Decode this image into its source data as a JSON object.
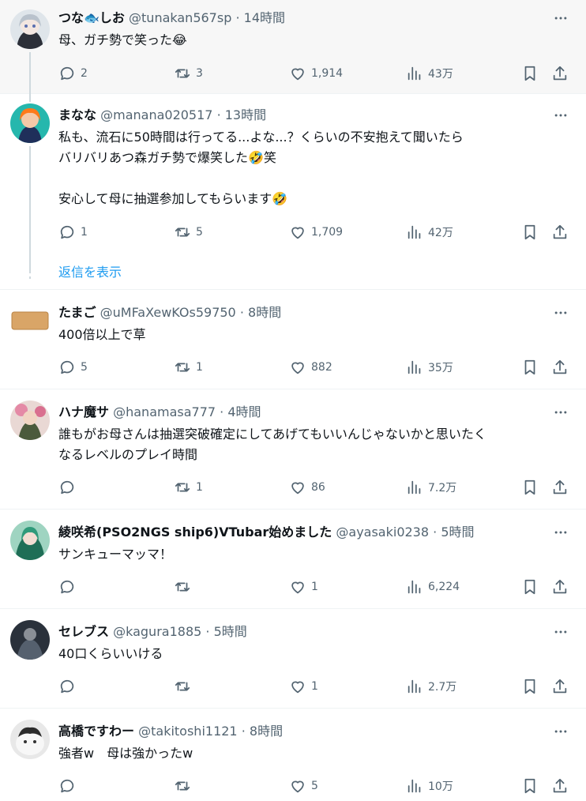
{
  "tweets": [
    {
      "name": "つな🐟しお",
      "handle": "@tunakan567sp",
      "time": "14時間",
      "text": "母、ガチ勢で笑った😂",
      "replies": "2",
      "retweets": "3",
      "likes": "1,914",
      "views": "43万",
      "avatar_color": "#c9d3dc"
    },
    {
      "name": "まなな",
      "handle": "@manana020517",
      "time": "13時間",
      "text": "私も、流石に50時間は行ってる...よな...？くらいの不安抱えて聞いたら\nバリバリあつ森ガチ勢で爆笑した🤣笑\n\n安心して母に抽選参加してもらいます🤣",
      "replies": "1",
      "retweets": "5",
      "likes": "1,709",
      "views": "42万",
      "avatar_color": "#2aa7a0"
    },
    {
      "name": "たまご",
      "handle": "@uMFaXewKOs59750",
      "time": "8時間",
      "text": "400倍以上で草",
      "replies": "5",
      "retweets": "1",
      "likes": "882",
      "views": "35万",
      "avatar_color": "#d9a567"
    },
    {
      "name": "ハナ魔サ",
      "handle": "@hanamasa777",
      "time": "4時間",
      "text": "誰もがお母さんは抽選突破確定にしてあげてもいいんじゃないかと思いたく\nなるレベルのプレイ時間",
      "replies": "",
      "retweets": "1",
      "likes": "86",
      "views": "7.2万",
      "avatar_color": "#7d8a6a"
    },
    {
      "name": "綾咲希(PSO2NGS ship6)VTubar始めました",
      "handle": "@ayasaki0238",
      "time": "5時間",
      "text": "サンキューマッマ！",
      "replies": "",
      "retweets": "",
      "likes": "1",
      "views": "6,224",
      "avatar_color": "#2f7a63"
    },
    {
      "name": "セレブス",
      "handle": "@kagura1885",
      "time": "5時間",
      "text": "40口くらいいける",
      "replies": "",
      "retweets": "",
      "likes": "1",
      "views": "2.7万",
      "avatar_color": "#3b4452"
    },
    {
      "name": "高橋ですわー",
      "handle": "@takitoshi1121",
      "time": "8時間",
      "text": "強者w　母は強かったw",
      "replies": "",
      "retweets": "",
      "likes": "5",
      "views": "10万",
      "avatar_color": "#6b6b6b"
    }
  ],
  "show_replies": "返信を表示",
  "icons": {
    "reply": "reply-icon",
    "retweet": "retweet-icon",
    "like": "heart-icon",
    "views": "views-icon",
    "bookmark": "bookmark-icon",
    "share": "share-icon",
    "more": "more-icon"
  }
}
